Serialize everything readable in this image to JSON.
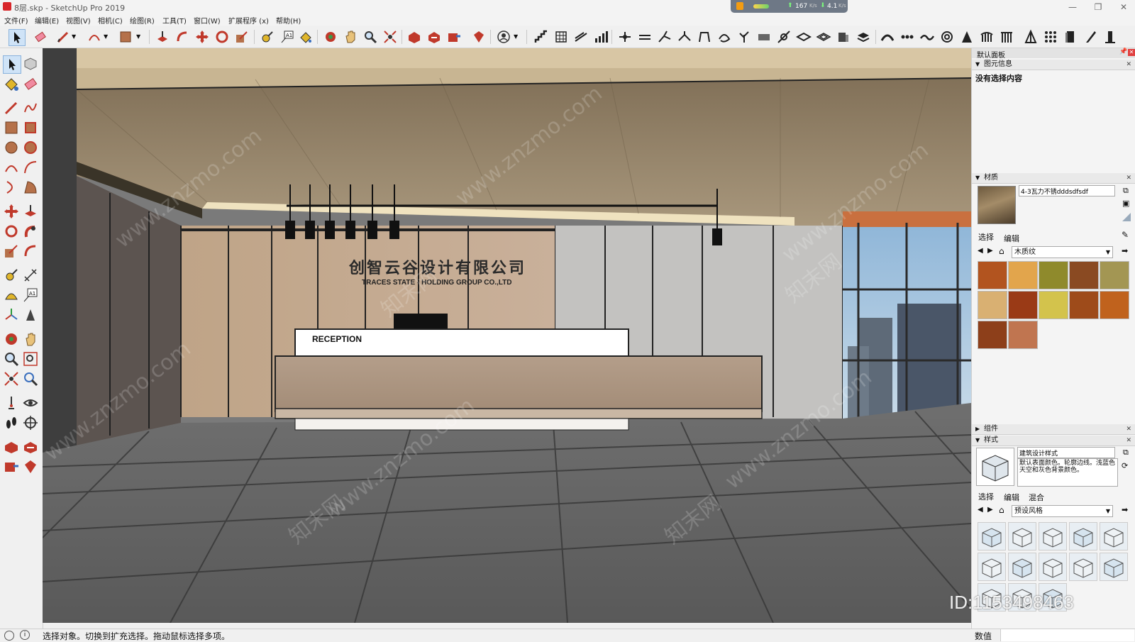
{
  "window": {
    "title": "8层.skp - SketchUp Pro 2019",
    "net_speed": {
      "up": "167",
      "up_unit": "K/s",
      "down": "4.1",
      "down_unit": "K/s"
    }
  },
  "menu": [
    "文件(F)",
    "编辑(E)",
    "视图(V)",
    "相机(C)",
    "绘图(R)",
    "工具(T)",
    "窗口(W)",
    "扩展程序 (x)",
    "帮助(H)"
  ],
  "scene": {
    "company_cn": "创智云谷设计有限公司",
    "company_en": "TRACES STATE - HOLDING GROUP CO.,LTD",
    "reception": "RECEPTION",
    "watermarks": [
      "www.znzmo.com",
      "知末网"
    ]
  },
  "tray": {
    "title": "默认面板",
    "entity_info": {
      "header": "图元信息",
      "text": "没有选择内容"
    },
    "materials": {
      "header": "材质",
      "current_name": "4-3瓦力不锈dddsdfsdf",
      "tabs": [
        "选择",
        "编辑"
      ],
      "library": "木质纹",
      "swatches": [
        "#b2541f",
        "#e2a54c",
        "#8f8a2c",
        "#8a4a22",
        "#a39653",
        "#d9b072",
        "#9a3a16",
        "#d3c34c",
        "#9e4b1a",
        "#c0621d",
        "#8d3f1a",
        "#c07550"
      ]
    },
    "components": {
      "header": "组件"
    },
    "styles": {
      "header": "样式",
      "name": "建筑设计样式",
      "description": "默认表面颜色。轮廓边线。浅蓝色天空和灰色背景颜色。",
      "tabs": [
        "选择",
        "编辑",
        "混合"
      ],
      "library": "预设风格"
    },
    "id_watermark": "ID:1153498463"
  },
  "status": {
    "message": "选择对象。切换到扩充选择。拖动鼠标选择多项。",
    "value_label": "数值"
  }
}
